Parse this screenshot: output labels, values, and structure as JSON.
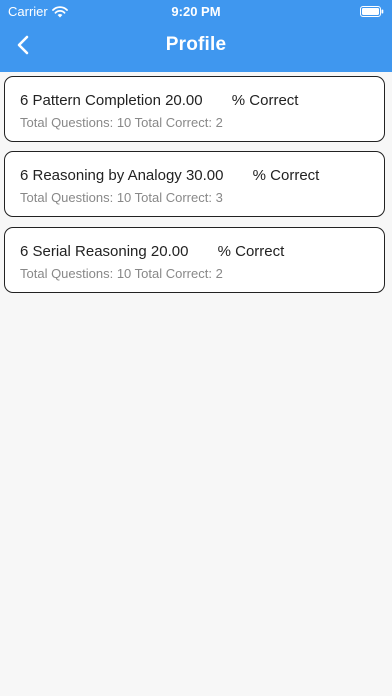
{
  "status_bar": {
    "carrier": "Carrier",
    "time": "9:20 PM"
  },
  "header": {
    "title": "Profile",
    "back_icon": "chevron-left-icon",
    "background_color": "#3f97ef"
  },
  "results": [
    {
      "title": "6 Pattern Completion 20.00       % Correct",
      "subtitle": "Total Questions: 10 Total Correct: 2"
    },
    {
      "title": "6 Reasoning by Analogy 30.00       % Correct",
      "subtitle": "Total Questions: 10 Total Correct: 3"
    },
    {
      "title": "6 Serial Reasoning 20.00       % Correct",
      "subtitle": "Total Questions: 10 Total Correct: 2"
    }
  ]
}
